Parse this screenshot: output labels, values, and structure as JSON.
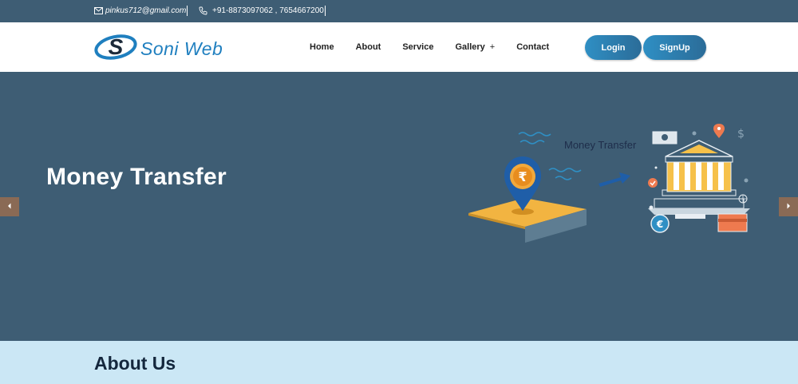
{
  "topbar": {
    "email": "pinkus712@gmail.com",
    "phone": "+91-8873097062 , 7654667200",
    "email_icon": "envelope-icon",
    "phone_icon": "phone-icon"
  },
  "header": {
    "logo_text": "Soni Web",
    "logo_icon": "soni-s-logo",
    "nav": {
      "home": "Home",
      "about": "About",
      "service": "Service",
      "gallery": "Gallery",
      "gallery_plus": "+",
      "contact": "Contact"
    },
    "login_label": "Login",
    "signup_label": "SignUp"
  },
  "hero": {
    "title": "Money Transfer",
    "illustration_caption": "Money Transfer",
    "prev_icon": "chevron-left-icon",
    "next_icon": "chevron-right-icon"
  },
  "about": {
    "title": "About Us"
  },
  "colors": {
    "hero_bg": "#3e5d74",
    "accent_blue": "#2f8fc4",
    "about_bg": "#cbe7f5",
    "arrow_bg": "#8a6a55"
  }
}
